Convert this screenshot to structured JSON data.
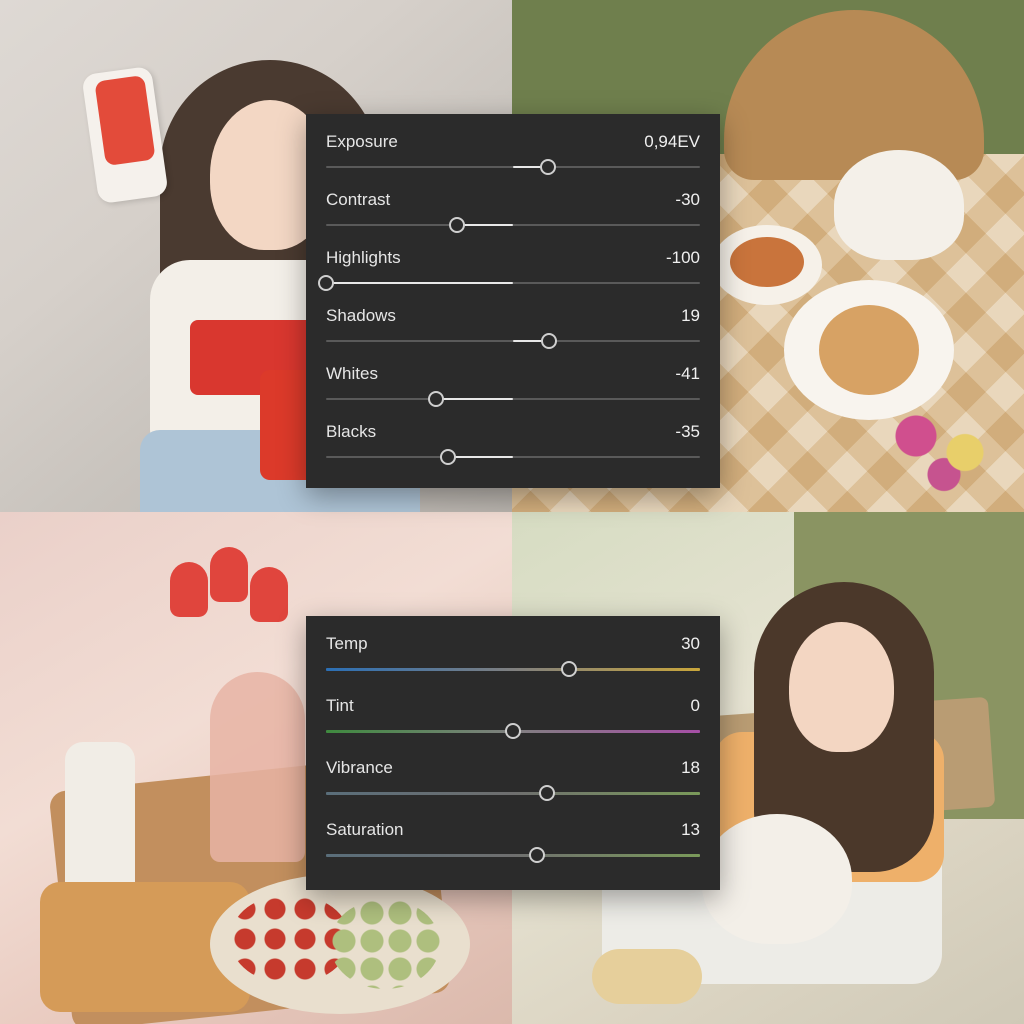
{
  "colors": {
    "panel_bg": "#2b2b2b",
    "text": "#e6e6e6"
  },
  "light_panel": {
    "sliders": [
      {
        "label": "Exposure",
        "value": "0,94EV",
        "min": -5,
        "max": 5,
        "num": 0.94
      },
      {
        "label": "Contrast",
        "value": "-30",
        "min": -100,
        "max": 100,
        "num": -30
      },
      {
        "label": "Highlights",
        "value": "-100",
        "min": -100,
        "max": 100,
        "num": -100
      },
      {
        "label": "Shadows",
        "value": "19",
        "min": -100,
        "max": 100,
        "num": 19
      },
      {
        "label": "Whites",
        "value": "-41",
        "min": -100,
        "max": 100,
        "num": -41
      },
      {
        "label": "Blacks",
        "value": "-35",
        "min": -100,
        "max": 100,
        "num": -35
      }
    ]
  },
  "color_panel": {
    "sliders": [
      {
        "label": "Temp",
        "value": "30",
        "min": -100,
        "max": 100,
        "num": 30,
        "rail": "temp"
      },
      {
        "label": "Tint",
        "value": "0",
        "min": -100,
        "max": 100,
        "num": 0,
        "rail": "tint"
      },
      {
        "label": "Vibrance",
        "value": "18",
        "min": -100,
        "max": 100,
        "num": 18,
        "rail": "vib"
      },
      {
        "label": "Saturation",
        "value": "13",
        "min": -100,
        "max": 100,
        "num": 13,
        "rail": "sat"
      }
    ]
  }
}
